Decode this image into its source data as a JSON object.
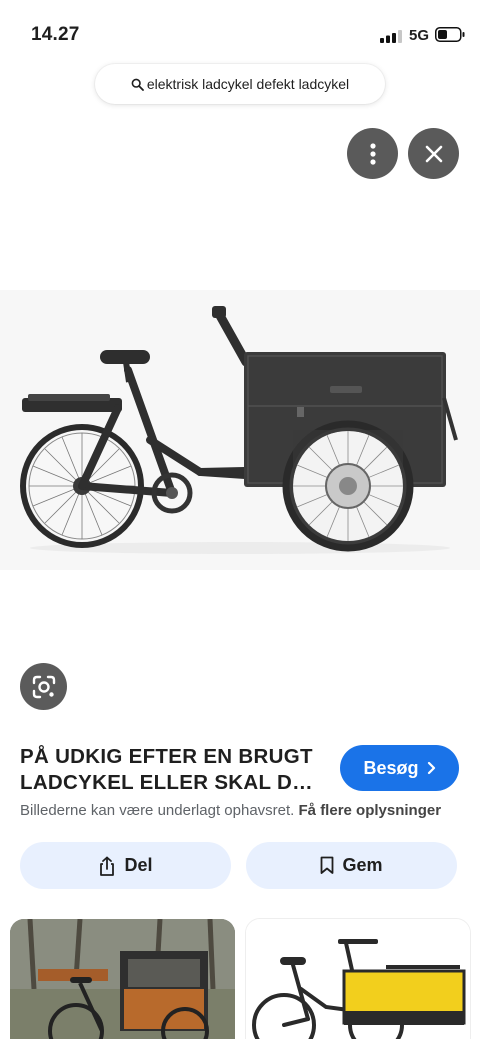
{
  "status_bar": {
    "time": "14.27",
    "network": "5G"
  },
  "search": {
    "query": "elektrisk ladcykel defekt ladcykel"
  },
  "icons": {
    "more": "more-vert-icon",
    "close": "close-icon",
    "lens": "google-lens-icon",
    "share": "share-icon",
    "save": "bookmark-icon",
    "visit_chevron": "chevron-right-icon"
  },
  "result": {
    "title": "PÅ UDKIG EFTER EN BRUGT LADCYKEL ELLER SKAL DU KØBE EN NY?",
    "visit_label": "Besøg",
    "copyright_text": "Billederne kan være underlagt ophavsret.",
    "more_info_label": "Få flere oplysninger"
  },
  "actions": {
    "share_label": "Del",
    "save_label": "Gem"
  },
  "colors": {
    "accent": "#1a73e8",
    "action_bg": "#e8f0fe",
    "icon_button_bg": "#5a5a5a"
  }
}
